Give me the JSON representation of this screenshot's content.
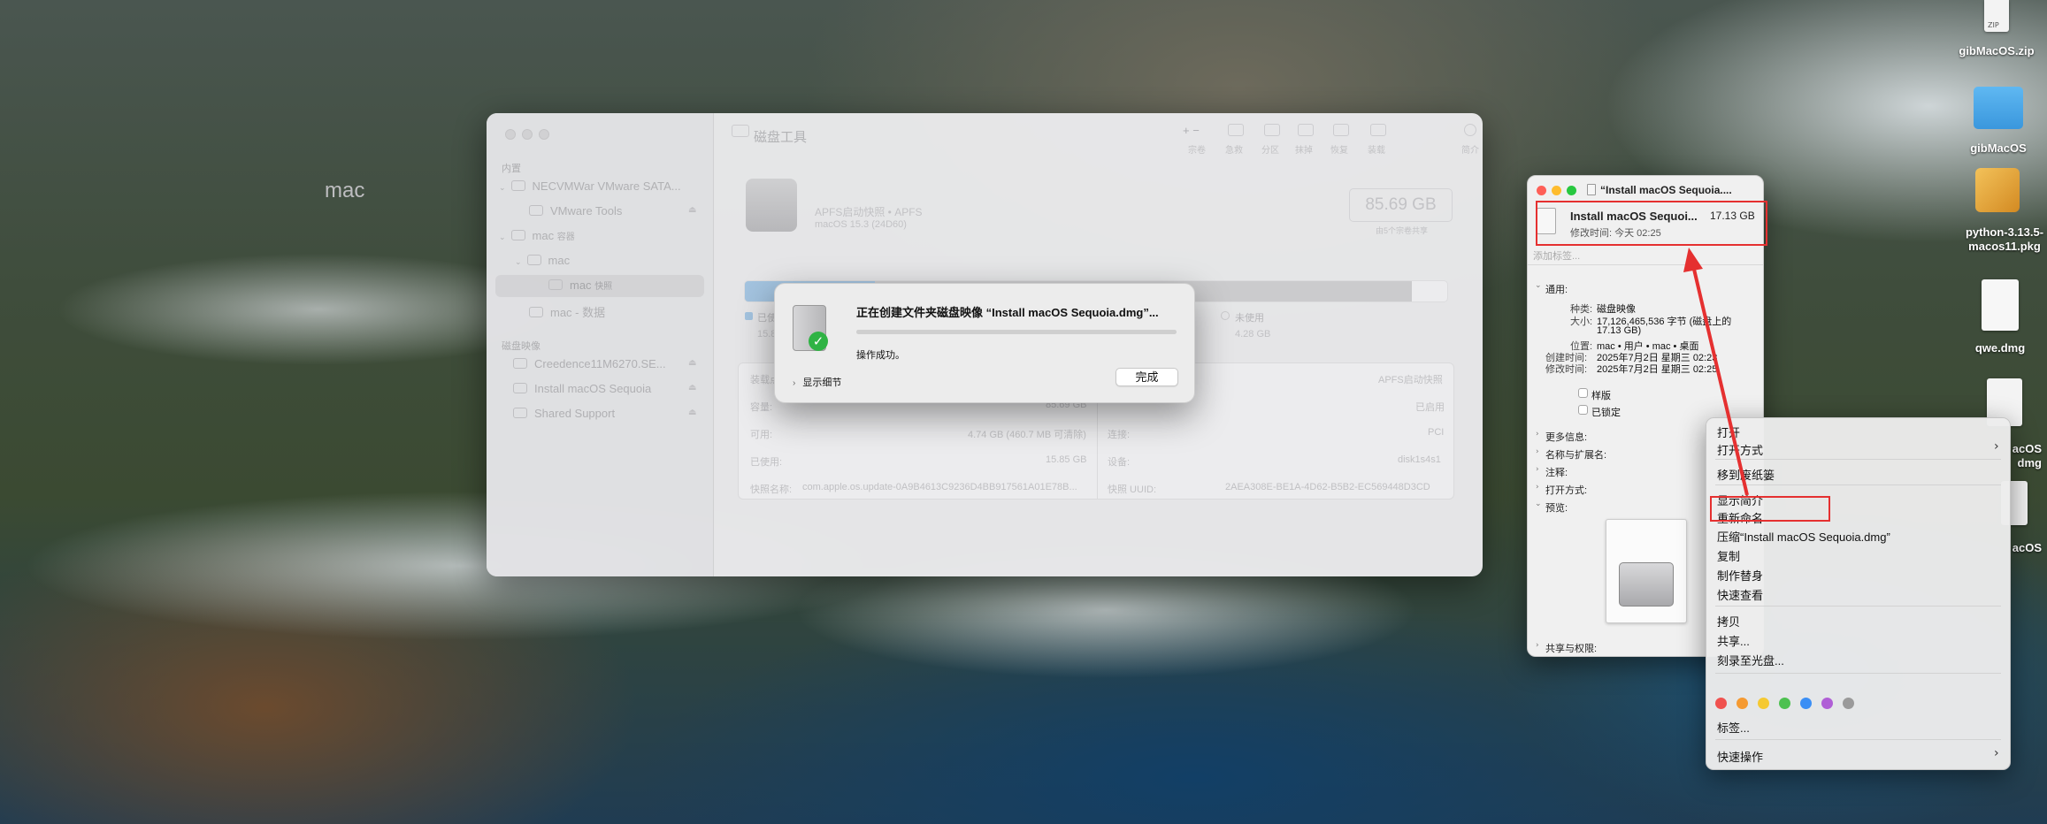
{
  "desktop": {
    "icons": [
      {
        "name": "gibmacos-zip",
        "label": "gibMacOS.zip",
        "badge": "ZIP"
      },
      {
        "name": "gibmacos-folder",
        "label": "gibMacOS"
      },
      {
        "name": "python-pkg",
        "label": "python-3.13.5-macos11.pkg"
      },
      {
        "name": "qwe-dmg",
        "label": "qwe.dmg"
      },
      {
        "name": "partial-1",
        "label": "acOS"
      },
      {
        "name": "partial-2",
        "label": "dmg"
      },
      {
        "name": "partial-3",
        "label": "acOS"
      }
    ]
  },
  "disk_utility": {
    "title": "磁盘工具",
    "sidebar": {
      "section_internal": "内置",
      "item_disk": "NECVMWar VMware SATA...",
      "item_vmware_tools": "VMware Tools",
      "item_container": "mac",
      "item_container_suffix": "容器",
      "item_volume_group": "mac",
      "item_snapshot": "mac",
      "item_snapshot_suffix": "快照",
      "item_data": "mac - 数据",
      "section_images": "磁盘映像",
      "img_1": "Creedence11M6270.SE...",
      "img_2": "Install macOS Sequoia",
      "img_3": "Shared Support"
    },
    "toolbar": {
      "labels": [
        "宗卷",
        "急救",
        "分区",
        "抹掉",
        "恢复",
        "装载",
        "简介"
      ],
      "plus_minus": "+ −"
    },
    "volume": {
      "name": "mac",
      "type": "APFS启动快照 • APFS",
      "os": "macOS 15.3 (24D60)",
      "capacity": "85.69 GB",
      "capacity_sub": "由5个宗卷共享"
    },
    "usage": {
      "used_fraction": 0.185,
      "other_fraction": 0.95,
      "legend_used": "已使",
      "legend_used_val": "15.8",
      "legend_free": "未使用",
      "legend_free_val": "4.28 GB"
    },
    "info": {
      "mount_label": "装载点",
      "capacity_label": "容量:",
      "capacity_val": "85.69 GB",
      "avail_label": "可用:",
      "avail_val": "4.74 GB (460.7 MB 可清除)",
      "used_label": "已使用:",
      "used_val": "15.85 GB",
      "snap_label": "快照名称:",
      "snap_val": "com.apple.os.update-0A9B4613C9236D4BB917561A01E78B...",
      "type_val": "APFS启动快照",
      "owners_val": "已启用",
      "conn_label": "连接:",
      "conn_val": "PCI",
      "device_label": "设备:",
      "device_val": "disk1s4s1",
      "snap_uuid_label": "快照 UUID:",
      "snap_uuid_val": "2AEA308E-BE1A-4D62-B5B2-EC569448D3CD"
    }
  },
  "progress_dialog": {
    "title": "正在创建文件夹磁盘映像 “Install macOS Sequoia.dmg”...",
    "status": "操作成功。",
    "progress": 1.0,
    "details_label": "显示细节",
    "done_button": "完成"
  },
  "get_info": {
    "window_title": "“Install macOS Sequoia....",
    "file_name": "Install macOS Sequoi...",
    "file_size": "17.13 GB",
    "modified": "修改时间: 今天 02:25",
    "tags_placeholder": "添加标签...",
    "section_general": "通用:",
    "kind_label": "种类:",
    "kind_val": "磁盘映像",
    "size_label": "大小:",
    "size_val": "17,126,465,536 字节 (磁盘上的",
    "size_val2": "17.13 GB)",
    "where_label": "位置:",
    "where_val": "mac • 用户 • mac • 桌面",
    "created_label": "创建时间:",
    "created_val": "2025年7月2日 星期三 02:23",
    "modified_label": "修改时间:",
    "modified_val": "2025年7月2日 星期三 02:25",
    "stationery": "样版",
    "locked": "已锁定",
    "more_info": "更多信息:",
    "name_ext": "名称与扩展名:",
    "comments": "注释:",
    "open_with": "打开方式:",
    "preview": "预览:",
    "sharing": "共享与权限:"
  },
  "context_menu": {
    "items": {
      "open": "打开",
      "open_with": "打开方式",
      "trash": "移到废纸篓",
      "get_info": "显示简介",
      "rename": "重新命名",
      "compress": "压缩“Install macOS Sequoia.dmg”",
      "duplicate": "复制",
      "alias": "制作替身",
      "quicklook": "快速查看",
      "copy": "拷贝",
      "share": "共享...",
      "burn": "刻录至光盘...",
      "tags": "标签...",
      "quick_actions": "快速操作"
    },
    "tag_colors": [
      "#f0524f",
      "#f59a32",
      "#f5c932",
      "#4dc150",
      "#3b8ff5",
      "#b05fd6",
      "#9a9a9a"
    ]
  },
  "annotation": {
    "color": "#e53030"
  }
}
